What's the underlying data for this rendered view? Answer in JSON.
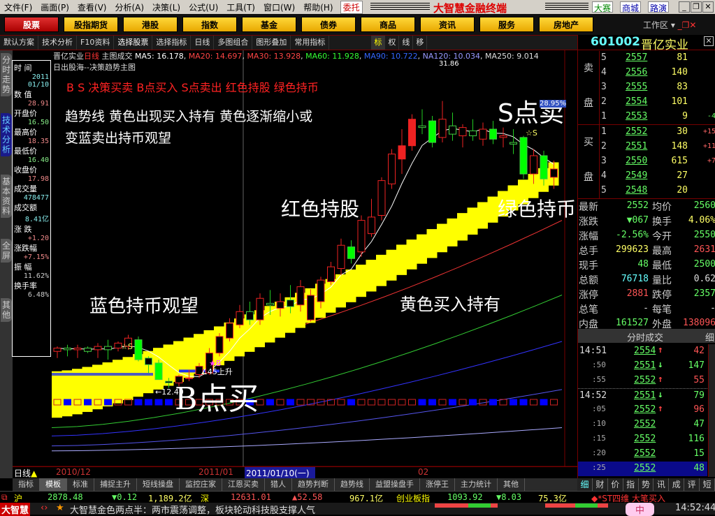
{
  "menu": [
    "文件(F)",
    "画面(P)",
    "查看(V)",
    "分析(A)",
    "决策(L)",
    "公式(U)",
    "工具(T)",
    "窗口(W)",
    "帮助(H)"
  ],
  "weituo": "委托",
  "app_title": "大智慧金融终端",
  "top_right": [
    "大赛",
    "商城",
    "路演"
  ],
  "categories": [
    "股票",
    "股指期货",
    "港股",
    "指数",
    "基金",
    "债券",
    "商品",
    "资讯",
    "服务",
    "房地产"
  ],
  "workzone": "工作区",
  "toolbar": [
    "默认方案",
    "技术分析",
    "F10资料",
    "选择股票",
    "选择指标",
    "日线",
    "多图组合",
    "图形叠加",
    "常用指标",
    "标",
    "权",
    "线",
    "移"
  ],
  "left_tabs": [
    "分时走势",
    "技术分析",
    "基本资料",
    "全屏",
    "其他"
  ],
  "legend": {
    "name": "晋亿实业",
    "period": "日线",
    "main": "主图成交",
    "ma5": "MA5: 16.178",
    "ma20": "MA20: 14.697",
    "ma30": "MA30: 13.928",
    "ma60": "MA60: 11.928",
    "ma90": "MA90: 10.722",
    "ma120": "NA120: 10.034",
    "ma250": "MA250: 9.014",
    "sub": "日出股海--决策趋势主图",
    "top_price": "31.86"
  },
  "info": [
    {
      "l": "时  间",
      "v": "2011",
      "c": "#8ee"
    },
    {
      "l": "",
      "v": "01/10",
      "c": "#8ee"
    },
    {
      "l": "数  值",
      "v": "28.91",
      "c": "#e88"
    },
    {
      "l": "开盘价",
      "v": "16.50",
      "c": "#8e8"
    },
    {
      "l": "最高价",
      "v": "18.35",
      "c": "#e88"
    },
    {
      "l": "最低价",
      "v": "16.40",
      "c": "#8e8"
    },
    {
      "l": "收盘价",
      "v": "17.98",
      "c": "#e88"
    },
    {
      "l": "成交量",
      "v": "478477",
      "c": "#8ee"
    },
    {
      "l": "成交额",
      "v": "8.41亿",
      "c": "#8ee"
    },
    {
      "l": "涨  跌",
      "v": "+1.20",
      "c": "#e88"
    },
    {
      "l": "涨跌幅",
      "v": "+7.15%",
      "c": "#e88"
    },
    {
      "l": "振  幅",
      "v": "11.62%",
      "c": "#ccc"
    },
    {
      "l": "换手率",
      "v": "6.48%",
      "c": "#ccc"
    }
  ],
  "annotations": {
    "red_line": "B  S  决策买卖  B点买入  S点卖出  红色持股  绿色持币",
    "trend1": "趋势线  黄色出现买入持有  黄色逐渐缩小或",
    "trend2": "变蓝卖出持币观望",
    "s_sell": "S点卖",
    "red_hold": "红色持股",
    "green_hold": "绿色持币",
    "blue_wait": "蓝色持币观望",
    "yellow_hold": "黄色买入持有",
    "b_buy": "B点买",
    "low_label": "←12.40",
    "angle": "∠45上升",
    "s_mark": "☆S",
    "b_mark": "★B",
    "pct": "28.95%"
  },
  "date_axis": {
    "period": "日线",
    "dates": [
      "2010/12",
      "2011/01",
      "2011/01/10(一)",
      "02"
    ]
  },
  "bottom_tabs": [
    "指标",
    "模板",
    "标准",
    "捕捉主升",
    "短线操盘",
    "监控庄家",
    "江恩买卖",
    "猎人",
    "趋势判断",
    "趋势线",
    "益盟操盘手",
    "涨停王",
    "主力统计",
    "其他"
  ],
  "stock": {
    "code": "601002",
    "name": "晋亿实业"
  },
  "asks": [
    {
      "n": "5",
      "p": "2557",
      "v": "81"
    },
    {
      "n": "4",
      "p": "2556",
      "v": "140"
    },
    {
      "n": "3",
      "p": "2555",
      "v": "83"
    },
    {
      "n": "2",
      "p": "2554",
      "v": "101"
    },
    {
      "n": "1",
      "p": "2553",
      "v": "9",
      "d": "-4"
    }
  ],
  "bids": [
    {
      "n": "1",
      "p": "2552",
      "v": "30",
      "d": "+15"
    },
    {
      "n": "2",
      "p": "2551",
      "v": "148",
      "d": "+11"
    },
    {
      "n": "3",
      "p": "2550",
      "v": "615",
      "d": "+7"
    },
    {
      "n": "4",
      "p": "2549",
      "v": "27"
    },
    {
      "n": "5",
      "p": "2548",
      "v": "20"
    }
  ],
  "ask_label": [
    "卖",
    "盘"
  ],
  "bid_label": [
    "买",
    "盘"
  ],
  "quote": [
    {
      "l": "最新",
      "v": "2552",
      "vc": "g",
      "l2": "均价",
      "v2": "2560",
      "v2c": "g"
    },
    {
      "l": "涨跌",
      "v": "▼067",
      "vc": "g",
      "l2": "换手",
      "v2": "4.06%",
      "v2c": "y"
    },
    {
      "l": "涨幅",
      "v": "-2.56%",
      "vc": "g",
      "l2": "今开",
      "v2": "2550",
      "v2c": "g"
    },
    {
      "l": "总手",
      "v": "299623",
      "vc": "y",
      "l2": "最高",
      "v2": "2631",
      "v2c": "r"
    },
    {
      "l": "现手",
      "v": "48",
      "vc": "g",
      "l2": "最低",
      "v2": "2500",
      "v2c": "g"
    },
    {
      "l": "总额",
      "v": "76718",
      "vc": "c",
      "l2": "量比",
      "v2": "0.62",
      "v2c": "w"
    },
    {
      "l": "涨停",
      "v": "2881",
      "vc": "r",
      "l2": "跌停",
      "v2": "2357",
      "v2c": "g"
    },
    {
      "l": "总笔",
      "v": "-",
      "vc": "w",
      "l2": "每笔",
      "v2": "-",
      "v2c": "w"
    },
    {
      "l": "内盘",
      "v": "161527",
      "vc": "g",
      "l2": "外盘",
      "v2": "138096",
      "v2c": "r"
    }
  ],
  "ticks_title": "分时成交",
  "ticks_detail": "细",
  "ticks": [
    {
      "t": "14:51",
      "p": "2554",
      "a": "↑",
      "v": "42",
      "vc": "r"
    },
    {
      "t": ":50",
      "p": "2551",
      "a": "↓",
      "v": "147",
      "vc": "g"
    },
    {
      "t": ":55",
      "p": "2552",
      "a": "↑",
      "v": "55",
      "vc": "r"
    },
    {
      "t": "14:52",
      "p": "2551",
      "a": "↓",
      "v": "79",
      "vc": "g"
    },
    {
      "t": ":05",
      "p": "2552",
      "a": "↑",
      "v": "96",
      "vc": "r"
    },
    {
      "t": ":10",
      "p": "2552",
      "a": "",
      "v": "47",
      "vc": "g"
    },
    {
      "t": ":15",
      "p": "2552",
      "a": "",
      "v": "116",
      "vc": "g"
    },
    {
      "t": ":20",
      "p": "2552",
      "a": "",
      "v": "15",
      "vc": "g"
    },
    {
      "t": ":25",
      "p": "2552",
      "a": "",
      "v": "48",
      "vc": "g"
    }
  ],
  "right_tabs": [
    "细",
    "财",
    "价",
    "指",
    "势",
    "讯",
    "成",
    "评",
    "短"
  ],
  "index": {
    "sh": "沪",
    "sh_val": "2878.48",
    "sh_chg": "▼0.12",
    "sh_amt": "1,189.2亿",
    "sz": "深",
    "sz_val": "12631.01",
    "sz_chg": "▲52.58",
    "sz_amt": "967.1亿",
    "cy": "创业板指",
    "cy_val": "1093.92",
    "cy_chg": "▼8.03",
    "cy_amt": "75.3亿",
    "alert": "◆*ST四维  大笔买入"
  },
  "ticker": {
    "logo": "大智慧",
    "text": "大智慧金色两点半：两市震荡调整，板块轮动科技股支撑人气",
    "time": "14:52:44",
    "ime": "中"
  },
  "chart_data": {
    "type": "candlestick",
    "price_range": [
      8,
      32
    ],
    "candles": [
      [
        14.6,
        14.9,
        14.2,
        14.8
      ],
      [
        14.8,
        15.0,
        14.3,
        14.7
      ],
      [
        14.7,
        15.0,
        14.2,
        14.8
      ],
      [
        14.8,
        14.9,
        14.5,
        14.6
      ],
      [
        14.7,
        15.1,
        14.2,
        14.9
      ],
      [
        14.9,
        15.3,
        14.1,
        14.7
      ],
      [
        14.8,
        15.2,
        14.6,
        15.1
      ],
      [
        14.9,
        15.6,
        14.7,
        15.4
      ],
      [
        15.3,
        15.5,
        14.0,
        14.1
      ],
      [
        14.2,
        14.3,
        13.3,
        13.8
      ],
      [
        13.9,
        14.1,
        12.9,
        12.9
      ],
      [
        12.8,
        13.0,
        12.4,
        12.7
      ],
      [
        12.7,
        13.2,
        12.5,
        13.1
      ],
      [
        13.0,
        13.5,
        12.8,
        13.0
      ],
      [
        13.2,
        13.9,
        13.0,
        13.7
      ],
      [
        13.3,
        14.8,
        13.2,
        14.5
      ],
      [
        14.5,
        15.7,
        14.3,
        15.5
      ],
      [
        15.4,
        16.6,
        15.2,
        16.3
      ],
      [
        16.2,
        17.4,
        16.0,
        17.0
      ],
      [
        17.0,
        17.6,
        16.2,
        16.5
      ],
      [
        16.5,
        18.1,
        16.2,
        17.8
      ],
      [
        17.5,
        18.3,
        16.8,
        17.4
      ],
      [
        17.2,
        18.1,
        16.7,
        17.6
      ],
      [
        17.7,
        18.6,
        16.9,
        17.3
      ],
      [
        17.4,
        18.9,
        17.0,
        18.5
      ],
      [
        16.5,
        18.35,
        16.4,
        17.98
      ],
      [
        17.6,
        19.1,
        17.2,
        18.9
      ],
      [
        18.8,
        20.0,
        18.6,
        19.7
      ],
      [
        19.6,
        21.4,
        19.2,
        21.0
      ],
      [
        20.9,
        21.3,
        19.9,
        20.2
      ],
      [
        20.6,
        22.8,
        20.3,
        22.5
      ],
      [
        21.7,
        23.8,
        21.5,
        22.7
      ],
      [
        22.8,
        25.1,
        22.5,
        24.9
      ],
      [
        24.7,
        26.8,
        24.4,
        26.5
      ],
      [
        26.2,
        28.0,
        25.3,
        27.0
      ],
      [
        27.0,
        28.9,
        26.7,
        28.6
      ],
      [
        28.2,
        29.2,
        27.7,
        28.1
      ],
      [
        28.5,
        28.8,
        26.9,
        27.2
      ],
      [
        27.5,
        29.7,
        27.2,
        28.6
      ],
      [
        28.2,
        29.0,
        27.3,
        27.7
      ],
      [
        27.6,
        28.3,
        26.9,
        28.1
      ],
      [
        27.9,
        28.6,
        27.3,
        27.6
      ],
      [
        27.4,
        28.4,
        27.0,
        28.0
      ],
      [
        28.0,
        28.5,
        27.1,
        27.4
      ],
      [
        27.5,
        28.1,
        26.9,
        27.6
      ],
      [
        27.2,
        28.0,
        26.5,
        27.1
      ],
      [
        27.5,
        27.6,
        25.0,
        25.3
      ],
      [
        25.3,
        26.8,
        24.7,
        26.4
      ],
      [
        26.4,
        26.7,
        24.6,
        25.0
      ],
      [
        25.1,
        26.1,
        24.4,
        25.6
      ]
    ],
    "ma_lines": [
      {
        "name": "MA20",
        "color": "#e33",
        "from": 13.2,
        "to": 22.5
      },
      {
        "name": "MA60",
        "color": "#3c3",
        "from": 10.0,
        "to": 18.0
      },
      {
        "name": "MA120",
        "color": "#33f",
        "from": 9.5,
        "to": 15.2
      },
      {
        "name": "MA250",
        "color": "#55e",
        "from": 8.9,
        "to": 12.3
      },
      {
        "name": "MA250b",
        "color": "#aaf",
        "from": 8.6,
        "to": 10.0
      }
    ]
  }
}
